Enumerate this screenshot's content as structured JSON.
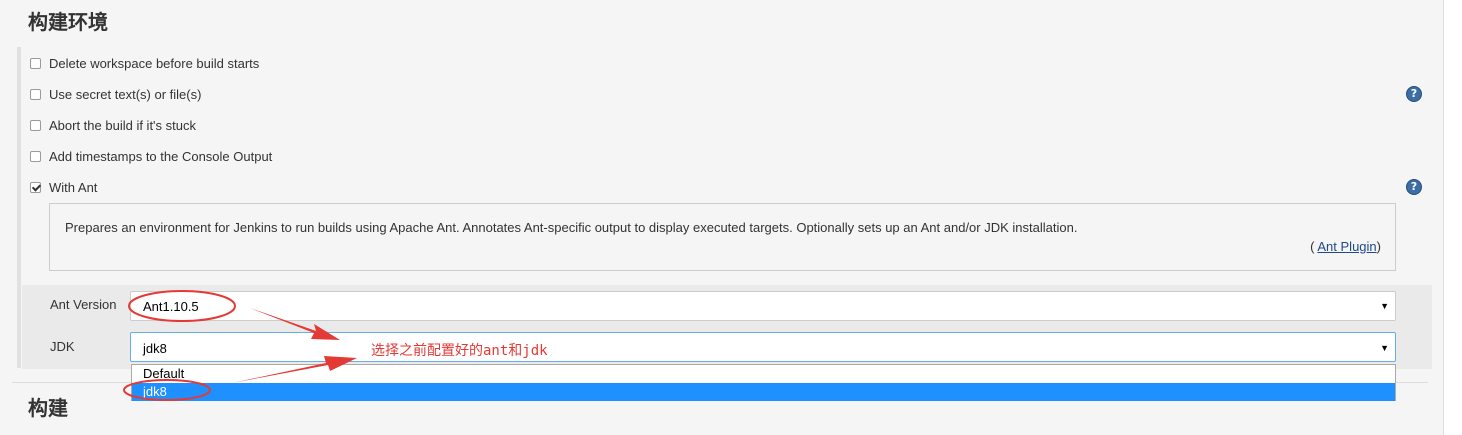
{
  "sections": {
    "environment_title": "构建环境",
    "build_title": "构建"
  },
  "options": [
    {
      "label": "Delete workspace before build starts",
      "checked": false
    },
    {
      "label": "Use secret text(s) or file(s)",
      "checked": false
    },
    {
      "label": "Abort the build if it's stuck",
      "checked": false
    },
    {
      "label": "Add timestamps to the Console Output",
      "checked": false
    },
    {
      "label": "With Ant",
      "checked": true
    }
  ],
  "help_icon": {
    "glyph": "?",
    "icon": "help-icon"
  },
  "ant_description": {
    "text": "Prepares an environment for Jenkins to run builds using Apache Ant. Annotates Ant-specific output to display executed targets. Optionally sets up an Ant and/or JDK installation.",
    "plugin_prefix": "(",
    "plugin_link": "Ant Plugin",
    "plugin_suffix": ")"
  },
  "ant_version": {
    "label": "Ant Version",
    "value": "Ant1.10.5",
    "arrow": "▼"
  },
  "jdk": {
    "label": "JDK",
    "value": "jdk8",
    "arrow": "▼"
  },
  "jdk_dropdown": {
    "options": [
      "Default",
      "jdk8"
    ],
    "highlighted": "jdk8"
  },
  "annotation": {
    "text": "选择之前配置好的ant和jdk",
    "color": "#e53935"
  },
  "colors": {
    "highlight": "#1e90ff",
    "help_icon": "#3a6ea5",
    "link": "#204a87"
  }
}
